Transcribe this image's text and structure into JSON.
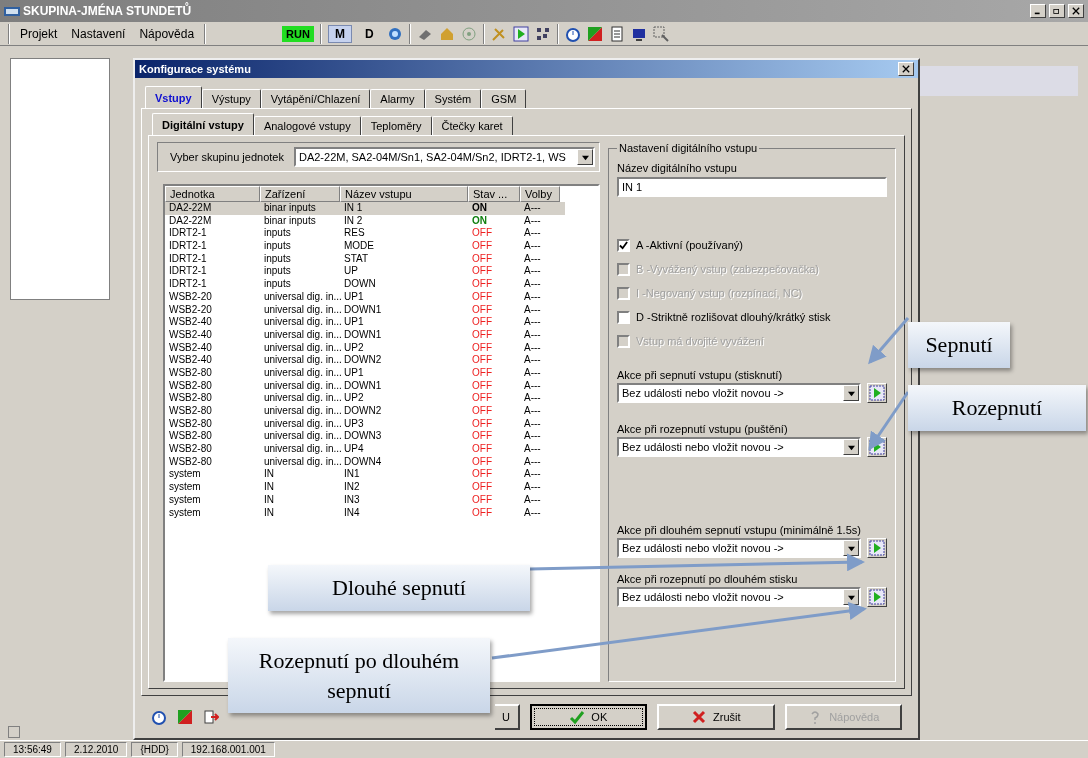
{
  "window": {
    "title": "SKUPINA-JMÉNA STUNDETŮ"
  },
  "menu": [
    "Projekt",
    "Nastavení",
    "Nápověda"
  ],
  "toolbar": {
    "run": "RUN",
    "mode_buttons": [
      {
        "label": "M",
        "selected": true
      },
      {
        "label": "D",
        "selected": false
      }
    ]
  },
  "dialog": {
    "title": "Konfigurace systému",
    "tabs": [
      {
        "label": "Vstupy",
        "selected": true
      },
      {
        "label": "Výstupy",
        "selected": false
      },
      {
        "label": "Vytápění/Chlazení",
        "selected": false
      },
      {
        "label": "Alarmy",
        "selected": false
      },
      {
        "label": "Systém",
        "selected": false
      },
      {
        "label": "GSM",
        "selected": false
      }
    ],
    "subtabs": [
      {
        "label": "Digitální vstupy",
        "selected": true
      },
      {
        "label": "Analogové vstupy",
        "selected": false
      },
      {
        "label": "Teploměry",
        "selected": false
      },
      {
        "label": "Čtečky karet",
        "selected": false
      }
    ],
    "group_select": {
      "label": "Vyber skupinu jednotek",
      "value": "DA2-22M, SA2-04M/Sn1, SA2-04M/Sn2, IDRT2-1, WS"
    },
    "table": {
      "columns": [
        "Jednotka",
        "Zařízení",
        "Název vstupu",
        "Stav ...",
        "Volby"
      ],
      "rows": [
        {
          "unit": "DA2-22M",
          "device": "binar inputs",
          "name": "IN 1",
          "state": "ON",
          "kind": "on",
          "options": "A---",
          "selected": true
        },
        {
          "unit": "DA2-22M",
          "device": "binar inputs",
          "name": "IN 2",
          "state": "ON",
          "kind": "on",
          "options": "A---",
          "selected": false
        },
        {
          "unit": "IDRT2-1",
          "device": "inputs",
          "name": "RES",
          "state": "OFF",
          "kind": "off",
          "options": "A---",
          "selected": false
        },
        {
          "unit": "IDRT2-1",
          "device": "inputs",
          "name": "MODE",
          "state": "OFF",
          "kind": "off",
          "options": "A---",
          "selected": false
        },
        {
          "unit": "IDRT2-1",
          "device": "inputs",
          "name": "STAT",
          "state": "OFF",
          "kind": "off",
          "options": "A---",
          "selected": false
        },
        {
          "unit": "IDRT2-1",
          "device": "inputs",
          "name": "UP",
          "state": "OFF",
          "kind": "off",
          "options": "A---",
          "selected": false
        },
        {
          "unit": "IDRT2-1",
          "device": "inputs",
          "name": "DOWN",
          "state": "OFF",
          "kind": "off",
          "options": "A---",
          "selected": false
        },
        {
          "unit": "WSB2-20",
          "device": "universal dig. in...",
          "name": "UP1",
          "state": "OFF",
          "kind": "off",
          "options": "A---",
          "selected": false
        },
        {
          "unit": "WSB2-20",
          "device": "universal dig. in...",
          "name": "DOWN1",
          "state": "OFF",
          "kind": "off",
          "options": "A---",
          "selected": false
        },
        {
          "unit": "WSB2-40",
          "device": "universal dig. in...",
          "name": "UP1",
          "state": "OFF",
          "kind": "off",
          "options": "A---",
          "selected": false
        },
        {
          "unit": "WSB2-40",
          "device": "universal dig. in...",
          "name": "DOWN1",
          "state": "OFF",
          "kind": "off",
          "options": "A---",
          "selected": false
        },
        {
          "unit": "WSB2-40",
          "device": "universal dig. in...",
          "name": "UP2",
          "state": "OFF",
          "kind": "off",
          "options": "A---",
          "selected": false
        },
        {
          "unit": "WSB2-40",
          "device": "universal dig. in...",
          "name": "DOWN2",
          "state": "OFF",
          "kind": "off",
          "options": "A---",
          "selected": false
        },
        {
          "unit": "WSB2-80",
          "device": "universal dig. in...",
          "name": "UP1",
          "state": "OFF",
          "kind": "off",
          "options": "A---",
          "selected": false
        },
        {
          "unit": "WSB2-80",
          "device": "universal dig. in...",
          "name": "DOWN1",
          "state": "OFF",
          "kind": "off",
          "options": "A---",
          "selected": false
        },
        {
          "unit": "WSB2-80",
          "device": "universal dig. in...",
          "name": "UP2",
          "state": "OFF",
          "kind": "off",
          "options": "A---",
          "selected": false
        },
        {
          "unit": "WSB2-80",
          "device": "universal dig. in...",
          "name": "DOWN2",
          "state": "OFF",
          "kind": "off",
          "options": "A---",
          "selected": false
        },
        {
          "unit": "WSB2-80",
          "device": "universal dig. in...",
          "name": "UP3",
          "state": "OFF",
          "kind": "off",
          "options": "A---",
          "selected": false
        },
        {
          "unit": "WSB2-80",
          "device": "universal dig. in...",
          "name": "DOWN3",
          "state": "OFF",
          "kind": "off",
          "options": "A---",
          "selected": false
        },
        {
          "unit": "WSB2-80",
          "device": "universal dig. in...",
          "name": "UP4",
          "state": "OFF",
          "kind": "off",
          "options": "A---",
          "selected": false
        },
        {
          "unit": "WSB2-80",
          "device": "universal dig. in...",
          "name": "DOWN4",
          "state": "OFF",
          "kind": "off",
          "options": "A---",
          "selected": false
        },
        {
          "unit": "system",
          "device": "IN",
          "name": "IN1",
          "state": "OFF",
          "kind": "off",
          "options": "A---",
          "selected": false
        },
        {
          "unit": "system",
          "device": "IN",
          "name": "IN2",
          "state": "OFF",
          "kind": "off",
          "options": "A---",
          "selected": false
        },
        {
          "unit": "system",
          "device": "IN",
          "name": "IN3",
          "state": "OFF",
          "kind": "off",
          "options": "A---",
          "selected": false
        },
        {
          "unit": "system",
          "device": "IN",
          "name": "IN4",
          "state": "OFF",
          "kind": "off",
          "options": "A---",
          "selected": false
        }
      ]
    },
    "settings": {
      "title": "Nastavení digitálního vstupu",
      "name_label": "Název digitálního vstupu",
      "name_value": "IN 1",
      "checkboxes": [
        {
          "label": "A -Aktivní (používaný)",
          "checked": true,
          "disabled": false
        },
        {
          "label": "B -Vyvážený vstup (zabezpečovačka)",
          "checked": false,
          "disabled": true
        },
        {
          "label": "I -Negovaný vstup (rozpínací, NC)",
          "checked": false,
          "disabled": true
        },
        {
          "label": "D -Striktně rozlišovat dlouhý/krátký stisk",
          "checked": false,
          "disabled": false
        },
        {
          "label": "Vstup má dvojité vyvážení",
          "checked": false,
          "disabled": true
        }
      ],
      "actions": [
        {
          "label": "Akce při sepnutí vstupu (stisknutí)",
          "value": "Bez události nebo vložit novou ->"
        },
        {
          "label": "Akce při rozepnutí vstupu (puštění)",
          "value": "Bez události nebo vložit novou ->"
        },
        {
          "label": "Akce při dlouhém sepnutí vstupu (minimálně 1.5s)",
          "value": "Bez události nebo vložit novou ->"
        },
        {
          "label": "Akce při rozepnutí po dlouhém stisku",
          "value": "Bez události nebo vložit novou ->"
        }
      ]
    },
    "buttons": [
      {
        "label": "U",
        "kind": "plain",
        "disabled": false
      },
      {
        "label": "OK",
        "kind": "ok",
        "disabled": false
      },
      {
        "label": "Zrušit",
        "kind": "cancel",
        "disabled": false
      },
      {
        "label": "Nápověda",
        "kind": "help",
        "disabled": true
      }
    ]
  },
  "callouts": [
    "Sepnutí",
    "Rozepnutí",
    "Dlouhé sepnutí",
    "Rozepnutí po dlouhém sepnutí"
  ],
  "status_bar": [
    "13:56:49",
    "2.12.2010",
    "{HDD}",
    "192.168.001.001"
  ]
}
